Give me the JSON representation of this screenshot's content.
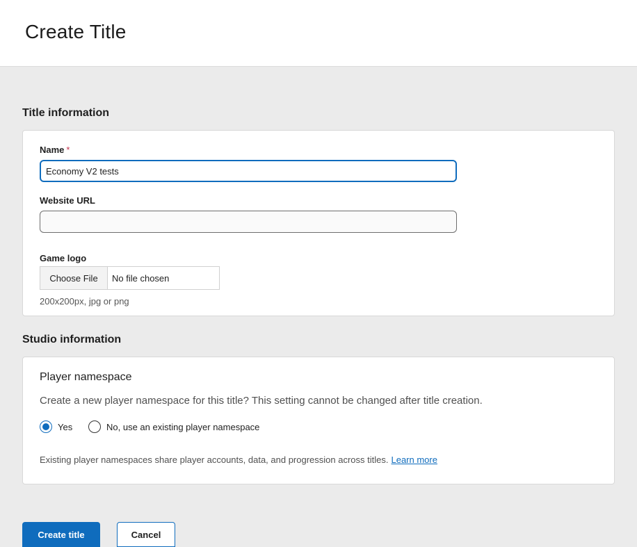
{
  "header": {
    "title": "Create Title"
  },
  "title_info": {
    "heading": "Title information",
    "name_label": "Name",
    "required_marker": "*",
    "name_value": "Economy V2 tests",
    "website_label": "Website URL",
    "website_value": "",
    "logo_label": "Game logo",
    "choose_file_label": "Choose File",
    "file_status": "No file chosen",
    "logo_hint": "200x200px, jpg or png"
  },
  "studio_info": {
    "heading": "Studio information",
    "namespace_heading": "Player namespace",
    "question": "Create a new player namespace for this title? This setting cannot be changed after title creation.",
    "options": [
      {
        "label": "Yes",
        "checked": true
      },
      {
        "label": "No, use an existing player namespace",
        "checked": false
      }
    ],
    "footnote": "Existing player namespaces share player accounts, data, and progression across titles.",
    "learn_more": "Learn more"
  },
  "actions": {
    "create_label": "Create title",
    "cancel_label": "Cancel"
  },
  "colors": {
    "accent": "#0f6cbd",
    "required": "#c4314b",
    "background": "#ebebeb"
  }
}
